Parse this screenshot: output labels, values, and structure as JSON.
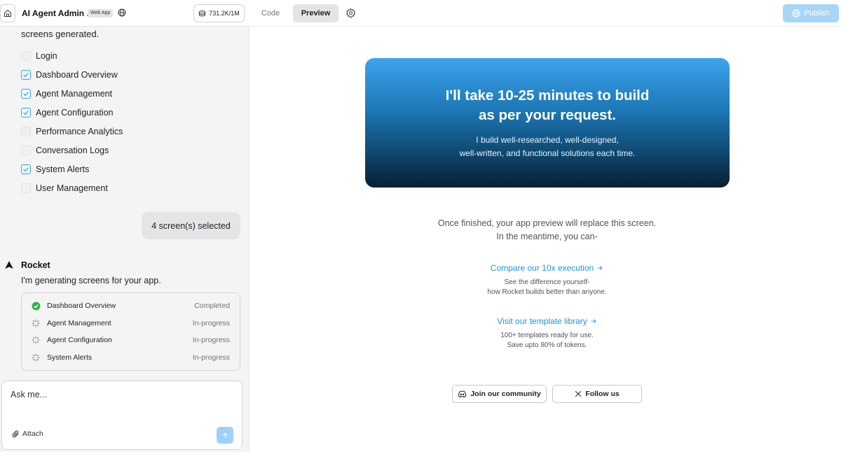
{
  "header": {
    "app_title": "AI Agent Admin ...",
    "badge": "Web App",
    "tokens": "731.2K/1M"
  },
  "sidebar": {
    "generated_text": "screens generated.",
    "screens": [
      {
        "label": "Login",
        "checked": false
      },
      {
        "label": "Dashboard Overview",
        "checked": true
      },
      {
        "label": "Agent Management",
        "checked": true
      },
      {
        "label": "Agent Configuration",
        "checked": true
      },
      {
        "label": "Performance Analytics",
        "checked": false
      },
      {
        "label": "Conversation Logs",
        "checked": false
      },
      {
        "label": "System Alerts",
        "checked": true
      },
      {
        "label": "User Management",
        "checked": false
      }
    ],
    "user_bubble": "4 screen(s) selected",
    "assistant_name": "Rocket",
    "assistant_message": "I'm generating screens for your app.",
    "progress": [
      {
        "name": "Dashboard Overview",
        "status": "Completed",
        "done": true
      },
      {
        "name": "Agent Management",
        "status": "In-progress",
        "done": false
      },
      {
        "name": "Agent Configuration",
        "status": "In-progress",
        "done": false
      },
      {
        "name": "System Alerts",
        "status": "In-progress",
        "done": false
      }
    ],
    "chat": {
      "placeholder": "Ask me...",
      "attach_label": "Attach"
    }
  },
  "toolbar": {
    "tab_code": "Code",
    "tab_preview": "Preview",
    "publish_label": "Publish"
  },
  "preview": {
    "hero_title_line1": "I'll take 10-25 minutes to build",
    "hero_title_line2": "as per your request.",
    "hero_sub_line1": "I build well-researched, well-designed,",
    "hero_sub_line2": "well-written, and functional solutions each time.",
    "finish_line1": "Once finished, your app preview will replace this screen.",
    "finish_line2": "In the meantime, you can-",
    "compare_link": "Compare our 10x execution",
    "compare_desc_line1": "See the difference yourself-",
    "compare_desc_line2": "how Rocket builds better than anyone.",
    "template_link": "Visit our template library",
    "template_desc_line1": "100+ templates ready for use.",
    "template_desc_line2": "Save upto 80% of tokens.",
    "community_button": "Join our community",
    "follow_button": "Follow us"
  },
  "colors": {
    "accent": "#1d94e6",
    "checkbox_border": "#38a5e8",
    "completed_green": "#2fb344",
    "publish_bg": "#a6d6f7"
  }
}
